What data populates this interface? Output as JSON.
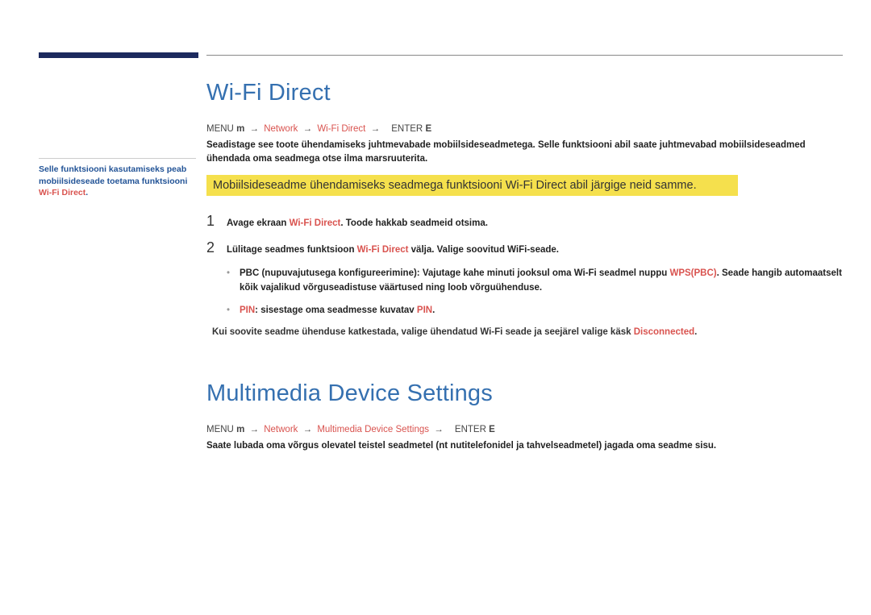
{
  "sidebar": {
    "text_part1": "Selle funktsiooni kasutamiseks peab mobiilsideseade toetama funktsiooni ",
    "wifi_direct": "Wi-Fi Direct",
    "period": "."
  },
  "section1": {
    "title": "Wi-Fi Direct",
    "breadcrumb": {
      "menu": "MENU",
      "menu_icon": "m",
      "network": "Network",
      "wifi_direct": "Wi-Fi Direct",
      "enter": "ENTER",
      "enter_icon": "E"
    },
    "desc": "Seadistage see toote ühendamiseks juhtmevabade mobiilsideseadmetega. Selle funktsiooni abil saate juhtmevabad mobiilsideseadmed ühendada oma seadmega otse ilma marsruuterita.",
    "highlight": "Mobiilsideseadme ühendamiseks seadmega funktsiooni Wi-Fi Direct abil järgige neid samme.",
    "step1": {
      "num": "1",
      "pre": "Avage ekraan ",
      "wifi": "Wi-Fi Direct",
      "post": ". Toode hakkab seadmeid otsima."
    },
    "step2": {
      "num": "2",
      "pre": "Lülitage seadmes funktsioon ",
      "wifi": "Wi-Fi Direct",
      "post": " välja. Valige soovitud WiFi-seade."
    },
    "sub1": {
      "text_a": "PBC (nupuvajutusega konfigureerimine):",
      "text_b": "Vajutage kahe minuti jooksul oma Wi-Fi seadmel nuppu ",
      "wps": "WPS(PBC)",
      "text_c": ". Seade hangib automaatselt kõik vajalikud võrguseadistuse väärtused ning loob võrguühenduse."
    },
    "sub2": {
      "pin": "PIN",
      "text_a": ": sisestage oma seadmesse kuvatav ",
      "pin2": "PIN",
      "period": "."
    },
    "note": {
      "pre": "Kui soovite seadme ühenduse katkestada, valige ühendatud Wi-Fi seade ja seejärel valige käsk ",
      "disc": "Disconnected",
      "period": "."
    }
  },
  "section2": {
    "title": "Multimedia Device Settings",
    "breadcrumb": {
      "menu": "MENU",
      "menu_icon": "m",
      "network": "Network",
      "mds": "Multimedia Device Settings",
      "enter": "ENTER",
      "enter_icon": "E"
    },
    "desc": "Saate lubada oma võrgus olevatel teistel seadmetel (nt nutitelefonidel ja tahvelseadmetel) jagada oma seadme sisu."
  }
}
